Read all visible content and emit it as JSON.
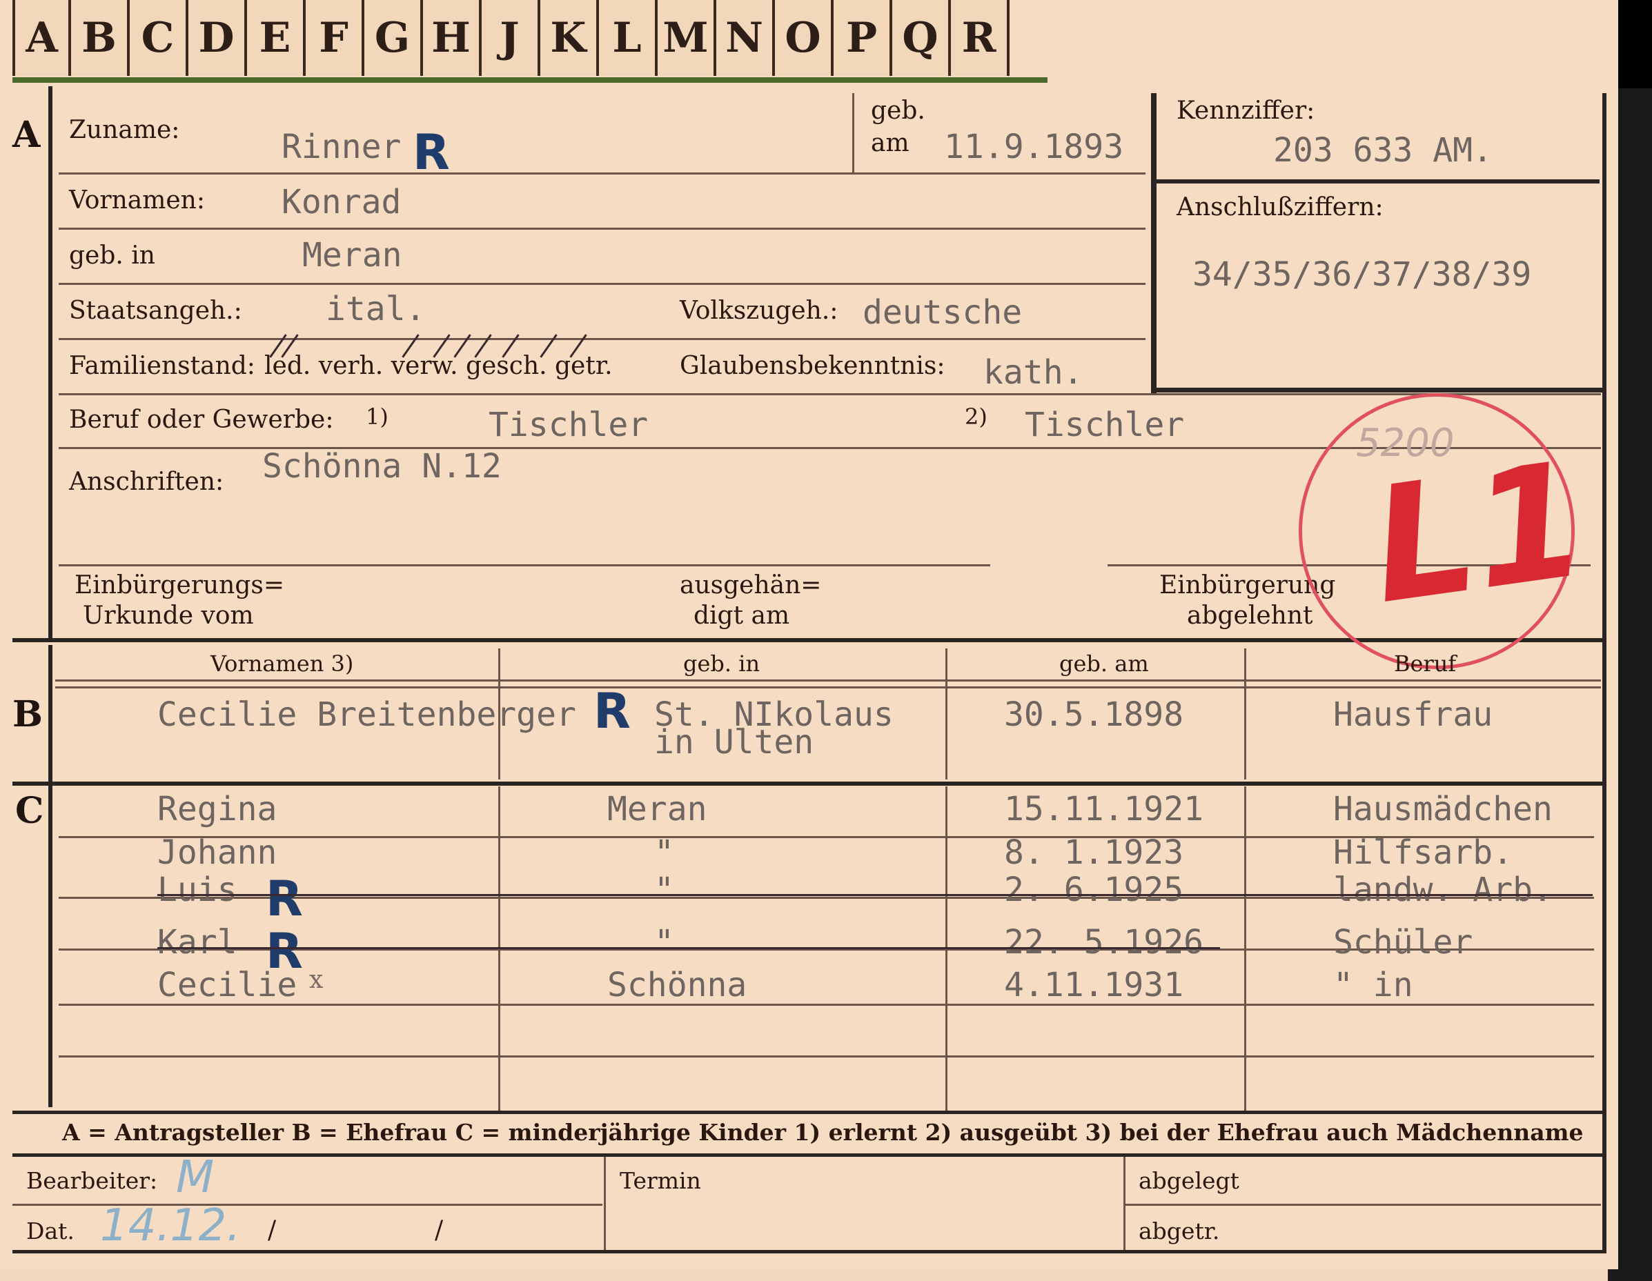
{
  "tabs": [
    "A",
    "B",
    "C",
    "D",
    "E",
    "F",
    "G",
    "H",
    "J",
    "K",
    "L",
    "M",
    "N",
    "O",
    "P",
    "Q",
    "R"
  ],
  "section_a": {
    "marker": "A",
    "surname_label": "Zuname:",
    "surname": "Rinner",
    "surname_mark": "R",
    "born_on_label1": "geb.",
    "born_on_label2": "am",
    "born_on": "11.9.1893",
    "first_names_label": "Vornamen:",
    "first_names": "Konrad",
    "born_in_label": "geb. in",
    "born_in": "Meran",
    "citizenship_label": "Staatsangeh.:",
    "citizenship": "ital.",
    "ethnicity_label": "Volkszugeh.:",
    "ethnicity": "deutsche",
    "marital_label": "Familienstand:",
    "marital_options": "led. verh. verw. gesch. getr.",
    "religion_label": "Glaubensbekenntnis:",
    "religion": "kath.",
    "occupation_label": "Beruf oder Gewerbe:",
    "occ_note1": "1)",
    "occupation_learned": "Tischler",
    "occ_note2": "2)",
    "occupation_practiced": "Tischler",
    "address_label": "Anschriften:",
    "address": "Schönna N.12",
    "naturalization_label1": "Einbürgerungs=",
    "naturalization_label2": "Urkunde vom",
    "handed_label1": "ausgehän=",
    "handed_label2": "digt am",
    "rejected_label1": "Einbürgerung",
    "rejected_label2": "abgelehnt"
  },
  "identifier": {
    "label": "Kennziffer:",
    "value": "203 633 AM.",
    "connection_label": "Anschlußziffern:",
    "connection_value": "34/35/36/37/38/39"
  },
  "stamp": {
    "number": "5200",
    "text": "L1"
  },
  "section_b": {
    "marker": "B",
    "headers": [
      "Vornamen 3)",
      "geb. in",
      "geb. am",
      "Beruf"
    ],
    "row": {
      "name": "Cecilie Breitenberger",
      "mark": "R",
      "born_in_line1": "St. NIkolaus",
      "born_in_line2": "in Ulten",
      "born_on": "30.5.1898",
      "occupation": "Hausfrau"
    }
  },
  "section_c": {
    "marker": "C",
    "rows": [
      {
        "name": "Regina",
        "mark": "",
        "place": "Meran",
        "date": "15.11.1921",
        "occupation": "Hausmädchen"
      },
      {
        "name": "Johann",
        "mark": "",
        "place": "\"",
        "date": "8. 1.1923",
        "occupation": "Hilfsarb."
      },
      {
        "name": "Luis",
        "mark": "R",
        "place": "\"",
        "date": "2. 6.1925",
        "occupation": "landw. Arb."
      },
      {
        "name": "Karl",
        "mark": "R",
        "place": "\"",
        "date": "22. 5.1926",
        "occupation": "Schüler"
      },
      {
        "name": "Cecilie",
        "mark": "x",
        "place": "Schönna",
        "date": "4.11.1931",
        "occupation": "\"     in"
      }
    ]
  },
  "legend": "A = Antragsteller   B = Ehefrau   C = minderjährige Kinder   1) erlernt   2) ausgeübt   3) bei der Ehefrau auch Mädchenname",
  "footer": {
    "worker_label": "Bearbeiter:",
    "worker_value": "M",
    "date_label": "Dat.",
    "date_value": "14.12.",
    "slash": "/",
    "deadline_label": "Termin",
    "filed_label": "abgelegt",
    "removed_label": "abgetr."
  }
}
